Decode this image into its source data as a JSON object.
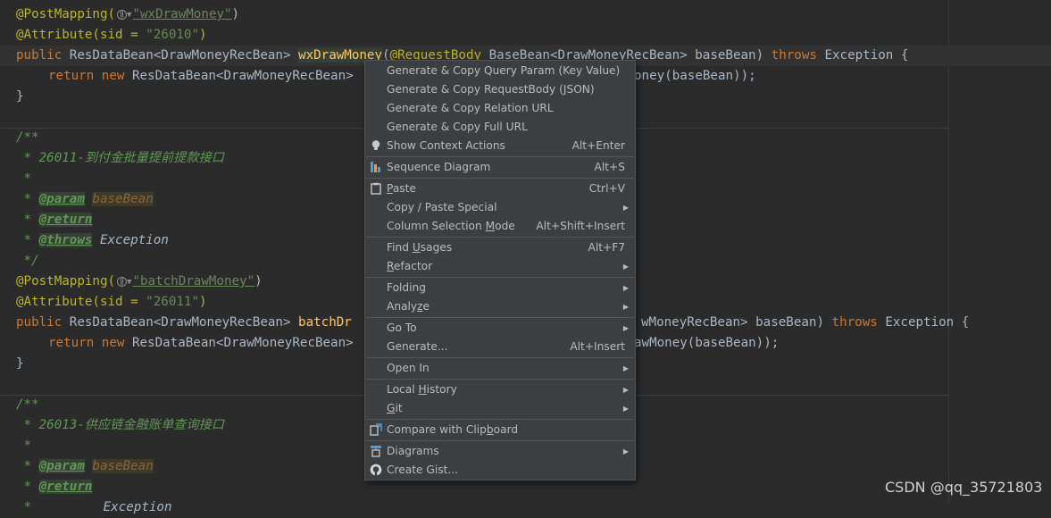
{
  "code": {
    "l1": {
      "ann": "@PostMapping(",
      "str": "\"wxDrawMoney\"",
      "close": ")"
    },
    "l2": {
      "a": "@Attribute(sid = ",
      "s": "\"26010\"",
      "c": ")"
    },
    "l3": {
      "kw1": "public ",
      "t1": "ResDataBean<DrawMoneyRecBean> ",
      "fn": "wxDrawMoney",
      "t2": "(",
      "a": "@RequestBody ",
      "t3": "BaseBean<DrawMoneyRecBean> baseBean) ",
      "kw2": "throws ",
      "t4": "Exception {"
    },
    "l4": {
      "kw1": "return ",
      "kw2": "new ",
      "t1": "ResDataBean<DrawMoneyRecBean>",
      "t2": "oney(baseBean));"
    },
    "l5": "}",
    "l6": "/**",
    "l7": " * 26011-到付金批量提前提款接口",
    "l8": " *",
    "l9": {
      "pre": " * ",
      "tag": "@param",
      "sp": " ",
      "p": "baseBean"
    },
    "l10": {
      "pre": " * ",
      "tag": "@return"
    },
    "l11": {
      "pre": " * ",
      "tag": "@throws",
      "sp": " ",
      "p": "Exception"
    },
    "l12": " */",
    "l13": {
      "ann": "@PostMapping(",
      "str": "\"batchDrawMoney\"",
      "close": ")"
    },
    "l14": {
      "a": "@Attribute(sid = ",
      "s": "\"26011\"",
      "c": ")"
    },
    "l15": {
      "kw1": "public ",
      "t1": "ResDataBean<DrawMoneyRecBean> ",
      "fn": "batchDr",
      "t2": "wMoneyRecBean> baseBean) ",
      "kw2": "throws ",
      "t3": "Exception {"
    },
    "l16": {
      "kw1": "return ",
      "kw2": "new ",
      "t1": "ResDataBean<DrawMoneyRecBean>",
      "t2": "awMoney(baseBean));"
    },
    "l17": "}",
    "l18": "/**",
    "l19": " * 26013-供应链金融账单查询接口",
    "l20": " *",
    "l21": {
      "pre": " * ",
      "tag": "@param",
      "sp": " ",
      "p": "baseBean"
    },
    "l22": {
      "pre": " * ",
      "tag": "@return"
    },
    "l23": {
      "pre": " * ",
      "p": "Exception"
    }
  },
  "menu": {
    "gen_query": "Generate & Copy Query Param (Key Value)",
    "gen_body": "Generate & Copy RequestBody (JSON)",
    "gen_relation": "Generate & Copy Relation URL",
    "gen_full": "Generate & Copy Full URL",
    "show_context": "Show Context Actions",
    "show_context_sc": "Alt+Enter",
    "sequence": "Sequence Diagram",
    "sequence_sc": "Alt+S",
    "paste_p": "P",
    "paste_rest": "aste",
    "paste_sc": "Ctrl+V",
    "copy_paste": "Copy / Paste Special",
    "col_sel_a": "Column Selection ",
    "col_sel_u": "M",
    "col_sel_b": "ode",
    "col_sel_sc": "Alt+Shift+Insert",
    "find_a": "Find ",
    "find_u": "U",
    "find_b": "sages",
    "find_sc": "Alt+F7",
    "refactor_u": "R",
    "refactor_b": "efactor",
    "folding": "Folding",
    "analyze_a": "Analy",
    "analyze_u": "z",
    "analyze_b": "e",
    "goto": "Go To",
    "generate": "Generate...",
    "generate_sc": "Alt+Insert",
    "open_in": "Open In",
    "local_a": "Local ",
    "local_u": "H",
    "local_b": "istory",
    "git_u": "G",
    "git_b": "it",
    "compare_a": "Compare with Clip",
    "compare_u": "b",
    "compare_b": "oard",
    "diagrams": "Diagrams",
    "create_gist": "Create Gist..."
  },
  "watermark": "CSDN @qq_35721803",
  "colors": {
    "editor_bg": "#2b2b2b",
    "menu_bg": "#3c3f41",
    "annotation": "#bbb529",
    "keyword": "#cc7832",
    "string": "#6a8759",
    "method": "#ffc66d",
    "comment": "#629755"
  },
  "icons": [
    "globe-icon",
    "lightbulb-icon",
    "sequence-diagram-icon",
    "clipboard-icon",
    "compare-icon",
    "diagrams-icon",
    "github-icon",
    "submenu-arrow-icon"
  ]
}
